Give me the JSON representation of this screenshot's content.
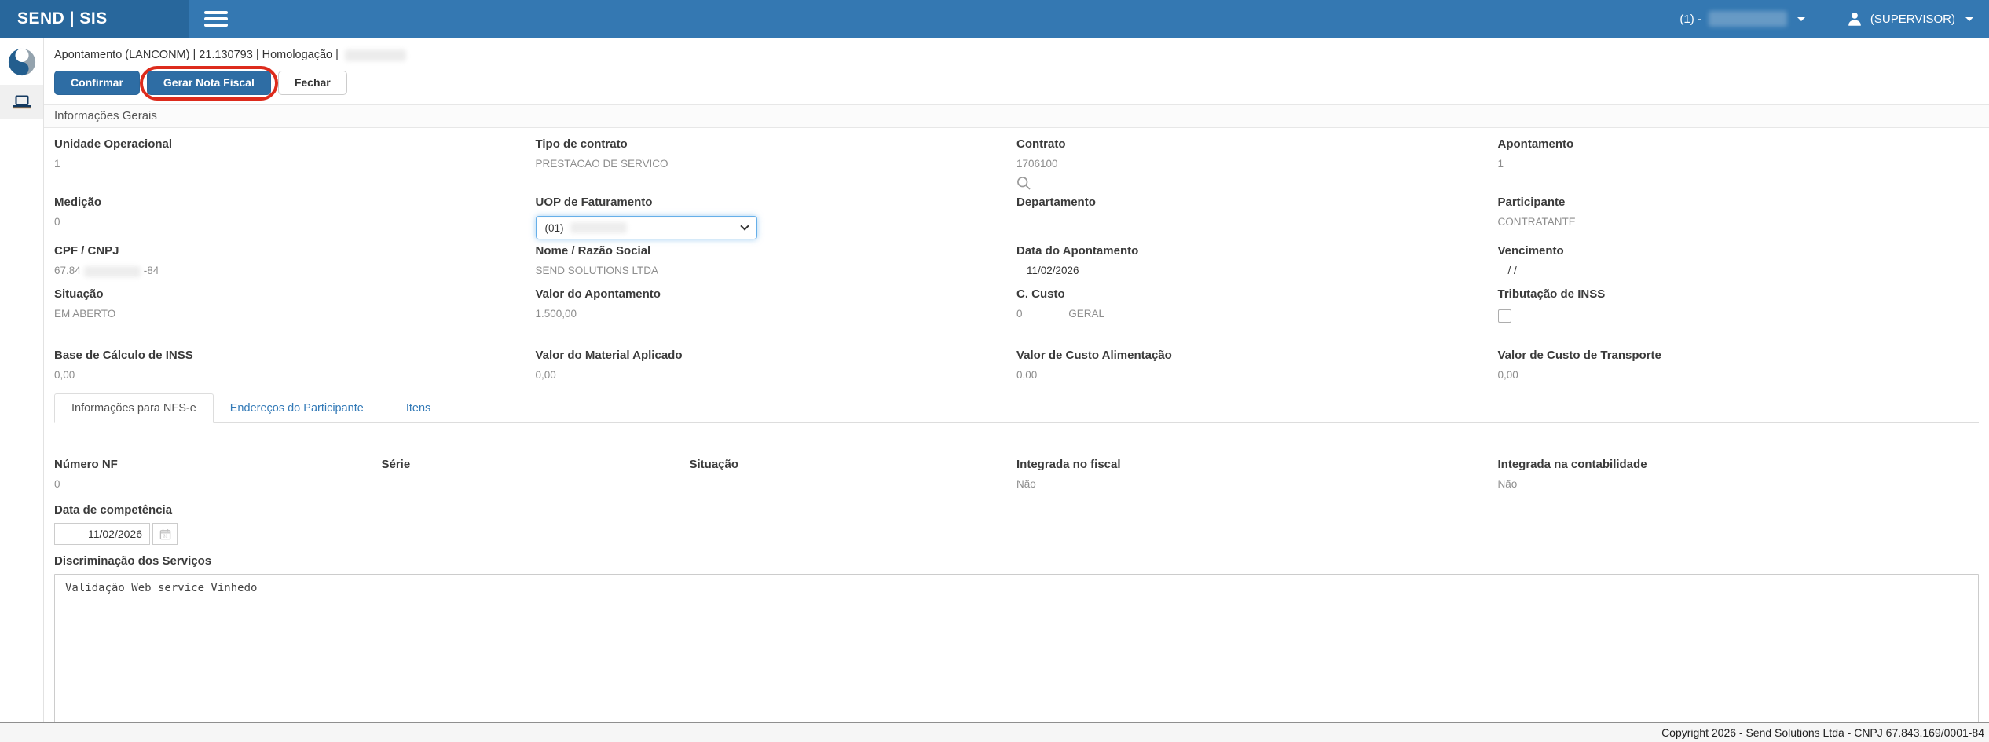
{
  "topbar": {
    "brand": "SEND | SIS",
    "company_prefix": "(1) -",
    "user_label": "(SUPERVISOR)"
  },
  "breadcrumb": {
    "text": "Apontamento (LANCONM) | 21.130793 | Homologação |"
  },
  "toolbar": {
    "confirm_label": "Confirmar",
    "generate_invoice_label": "Gerar Nota Fiscal",
    "close_label": "Fechar"
  },
  "section": {
    "title": "Informações Gerais"
  },
  "fields": {
    "unidade_operacional": {
      "label": "Unidade Operacional",
      "value": "1"
    },
    "tipo_contrato": {
      "label": "Tipo de contrato",
      "value": "PRESTACAO DE SERVICO"
    },
    "contrato": {
      "label": "Contrato",
      "value": "1706100"
    },
    "apontamento": {
      "label": "Apontamento",
      "value": "1"
    },
    "medicao": {
      "label": "Medição",
      "value": "0"
    },
    "uop_faturamento": {
      "label": "UOP de Faturamento",
      "value": "(01)"
    },
    "departamento": {
      "label": "Departamento",
      "value": ""
    },
    "participante": {
      "label": "Participante",
      "value": "CONTRATANTE"
    },
    "cpf_cnpj": {
      "label": "CPF / CNPJ",
      "value_prefix": "67.84",
      "value_suffix": "-84"
    },
    "nome_razao_social": {
      "label": "Nome / Razão Social",
      "value": "SEND SOLUTIONS LTDA"
    },
    "data_apontamento": {
      "label": "Data do Apontamento",
      "value": "11/02/2026"
    },
    "vencimento": {
      "label": "Vencimento",
      "value": "/ /"
    },
    "situacao": {
      "label": "Situação",
      "value": "EM ABERTO"
    },
    "valor_apontamento": {
      "label": "Valor do Apontamento",
      "value": "1.500,00"
    },
    "c_custo": {
      "label": "C. Custo",
      "code": "0",
      "descr": "GERAL"
    },
    "tributacao_inss": {
      "label": "Tributação de INSS",
      "checked": false
    },
    "base_calculo_inss": {
      "label": "Base de Cálculo de INSS",
      "value": "0,00"
    },
    "valor_material": {
      "label": "Valor do Material Aplicado",
      "value": "0,00"
    },
    "custo_alimentacao": {
      "label": "Valor de Custo Alimentação",
      "value": "0,00"
    },
    "custo_transporte": {
      "label": "Valor de Custo de Transporte",
      "value": "0,00"
    }
  },
  "tabs": [
    {
      "label": "Informações para NFS-e",
      "active": true
    },
    {
      "label": "Endereços do Participante",
      "active": false
    },
    {
      "label": "Itens",
      "active": false
    }
  ],
  "nfse": {
    "numero_nf": {
      "label": "Número NF",
      "value": "0"
    },
    "serie": {
      "label": "Série",
      "value": ""
    },
    "situacao": {
      "label": "Situação",
      "value": ""
    },
    "integrada_fiscal": {
      "label": "Integrada no fiscal",
      "value": "Não"
    },
    "integrada_contabilidade": {
      "label": "Integrada na contabilidade",
      "value": "Não"
    },
    "data_competencia": {
      "label": "Data de competência",
      "value": "11/02/2026"
    },
    "discriminacao": {
      "label": "Discriminação dos Serviços",
      "value": "Validação Web service Vinhedo"
    }
  },
  "footer": {
    "copyright": "Copyright 2026 - Send Solutions Ltda - CNPJ 67.843.169/0001-84"
  },
  "colors": {
    "navbar": "#3478b2",
    "navbar_brand": "#28679c",
    "primary_button": "#2e6da4",
    "annotation_red": "#dd2b1c",
    "link_blue": "#337ab7"
  }
}
